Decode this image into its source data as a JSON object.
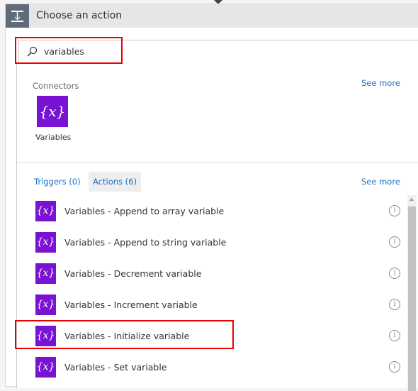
{
  "header": {
    "title": "Choose an action",
    "icon": "action-step-icon"
  },
  "search": {
    "value": "variables",
    "icon": "search-icon"
  },
  "connectors": {
    "label": "Connectors",
    "see_more": "See more",
    "items": [
      {
        "label": "Variables",
        "icon": "variables-icon",
        "glyph": "{x}"
      }
    ]
  },
  "tabs": {
    "triggers": "Triggers (0)",
    "actions": "Actions (6)",
    "see_more": "See more",
    "active": "actions"
  },
  "actions": [
    {
      "label": "Variables - Append to array variable",
      "glyph": "{x}"
    },
    {
      "label": "Variables - Append to string variable",
      "glyph": "{x}"
    },
    {
      "label": "Variables - Decrement variable",
      "glyph": "{x}"
    },
    {
      "label": "Variables - Increment variable",
      "glyph": "{x}"
    },
    {
      "label": "Variables - Initialize variable",
      "glyph": "{x}"
    },
    {
      "label": "Variables - Set variable",
      "glyph": "{x}"
    }
  ],
  "info_glyph": "i",
  "colors": {
    "accent": "#7a12d4",
    "link": "#1f6fbf",
    "highlight": "#e00000"
  }
}
